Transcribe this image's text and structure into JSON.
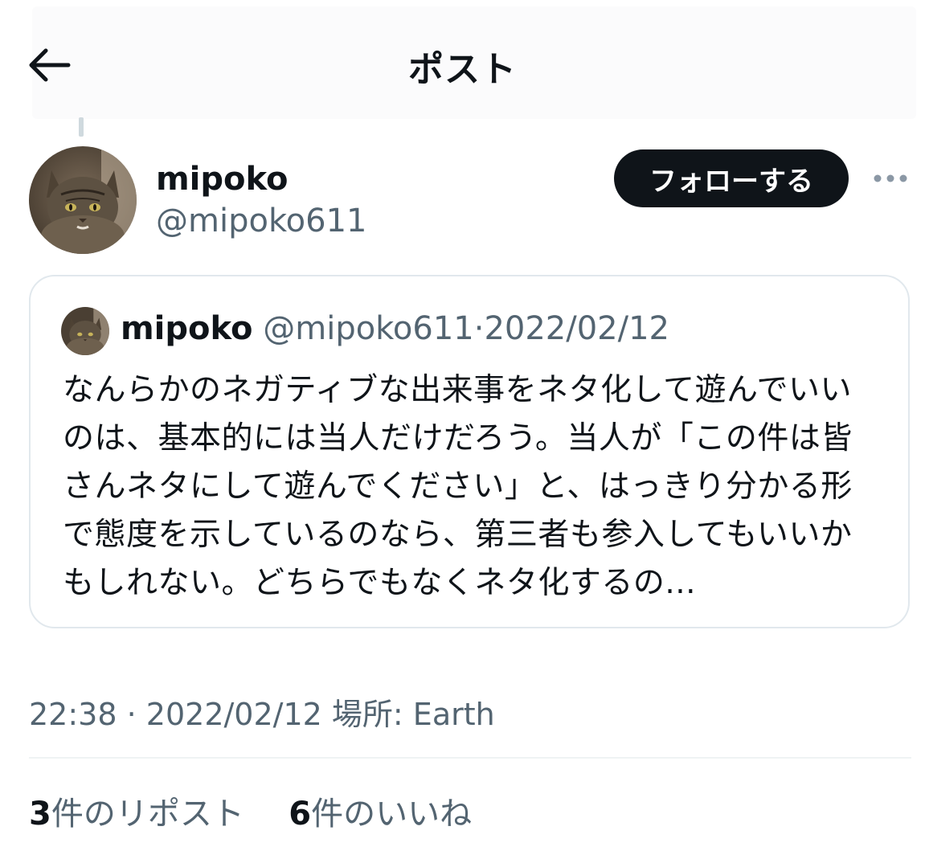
{
  "header": {
    "title": "ポスト",
    "back_icon": "arrow-left-icon"
  },
  "author": {
    "name": "mipoko",
    "handle": "@mipoko611",
    "avatar_icon": "cat-avatar"
  },
  "follow_button": {
    "label": "フォローする"
  },
  "more_icon": "more-horizontal-icon",
  "quote": {
    "name": "mipoko",
    "handle": "@mipoko611",
    "separator": "·",
    "date": "2022/02/12",
    "text": "なんらかのネガティブな出来事をネタ化して遊んでいいのは、基本的には当人だけだろう。当人が「この件は皆さんネタにして遊んでください」と、はっきり分かる形で態度を示しているのなら、第三者も参入してもいいかもしれない。どちらでもなくネタ化するの..."
  },
  "timestamp": {
    "time": "22:38",
    "separator": "·",
    "date": "2022/02/12",
    "location": "場所: Earth"
  },
  "stats": {
    "reposts_count": "3",
    "reposts_label": "件のリポスト",
    "likes_count": "6",
    "likes_label": "件のいいね"
  },
  "colors": {
    "text_primary": "#0f1419",
    "text_secondary": "#536471",
    "border": "#e1e8ed",
    "button_bg": "#0f1419"
  }
}
